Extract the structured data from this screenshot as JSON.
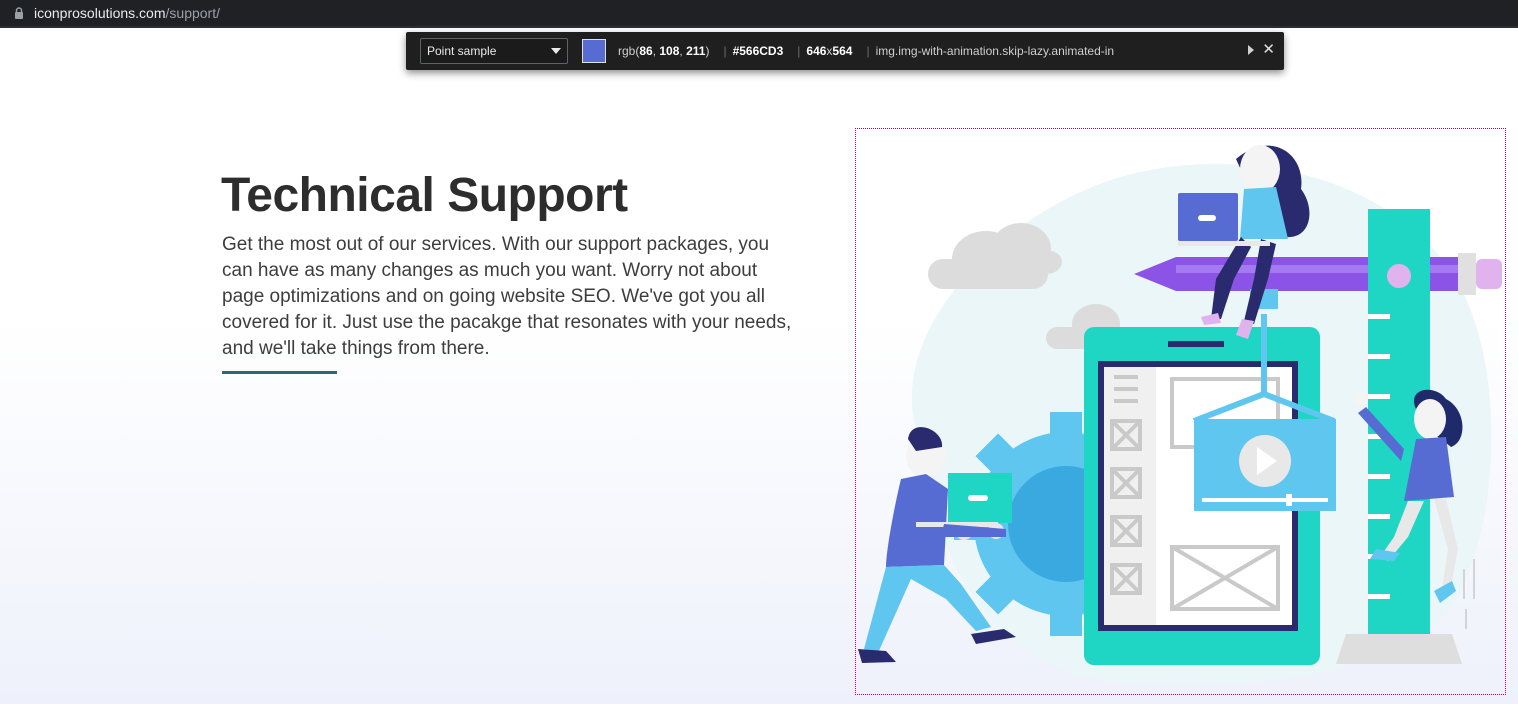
{
  "browser": {
    "url_host": "iconprosolutions.com",
    "url_path": "/support/"
  },
  "picker": {
    "mode": "Point sample",
    "rgb_prefix": "rgb(",
    "rgb_r": "86",
    "rgb_g": "108",
    "rgb_b": "211",
    "rgb_suffix": ")",
    "hex": "#566CD3",
    "width": "646",
    "height": "564",
    "selector": "img.img-with-animation.skip-lazy.animated-in",
    "sampled_color": "#566CD3"
  },
  "hero": {
    "title": "Technical Support",
    "description": "Get the most out of our services. With our support packages, you can have as many changes as much you want. Worry not about page optimizations and on going website SEO. We've got you all covered for it. Just use the pacakge that resonates with your needs, and we'll take things from there.",
    "underline_color": "#2d6877"
  },
  "illustration": {
    "icon": "support-team-illustration"
  }
}
